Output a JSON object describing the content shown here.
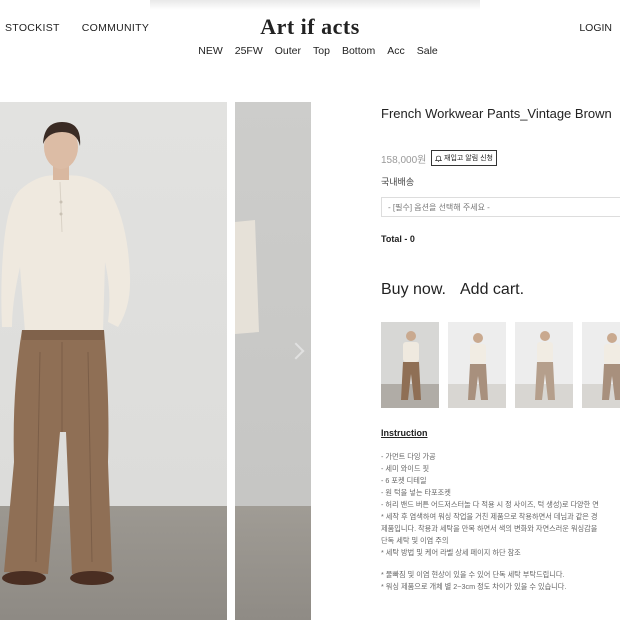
{
  "header": {
    "left_links": [
      "STOCKIST",
      "COMMUNITY"
    ],
    "logo": "Art if acts",
    "login": "LOGIN",
    "categories": [
      "NEW",
      "25FW",
      "Outer",
      "Top",
      "Bottom",
      "Acc",
      "Sale"
    ]
  },
  "product": {
    "title": "French Workwear Pants_Vintage Brown",
    "price": "158,000원",
    "restock_label": "재입고 알림 신청",
    "shipping": "국내배송",
    "option_placeholder": "- [필수] 옵션을 선택해 주세요 -",
    "total": "Total - 0",
    "buy_label": "Buy now.",
    "cart_label": "Add cart."
  },
  "instruction": {
    "title": "Instruction",
    "lines": [
      "- 가먼트 다잉 가공",
      "- 세미 와이드 핏",
      "- 6 포켓 디테일",
      "- 원 턱을 넣는 타포조켓",
      "- 허리 밴드 버튼 어드저스터놀 다 적용 시 정 사이즈, 턱 생성)로 다양한 연",
      "* 세작 후 염색하여 워싱 작업을 거친 제품으로 착용하면서 데님과 같은 경",
      "제품입니다. 착용과 세탁을 만복 하면서 색의 변화와 자연스러운 워싱감을",
      "단독 세탁 및 이염 주의",
      "* 세탁 방법 및 케어 라벨 상세 페이지 하단 참조"
    ],
    "notes": [
      "* 물빠짐 및 이염 현상이 있을 수 있어 단독 세탁 부탁드립니다.",
      "* 워싱 제품으로 개체 별 2~3cm 정도 차이가 있을 수 있습니다."
    ]
  },
  "colors": {
    "pants": "#8f6f55",
    "shirt": "#efe9df",
    "studio_wall": "#dcdcda",
    "studio_floor": "#94908a"
  }
}
